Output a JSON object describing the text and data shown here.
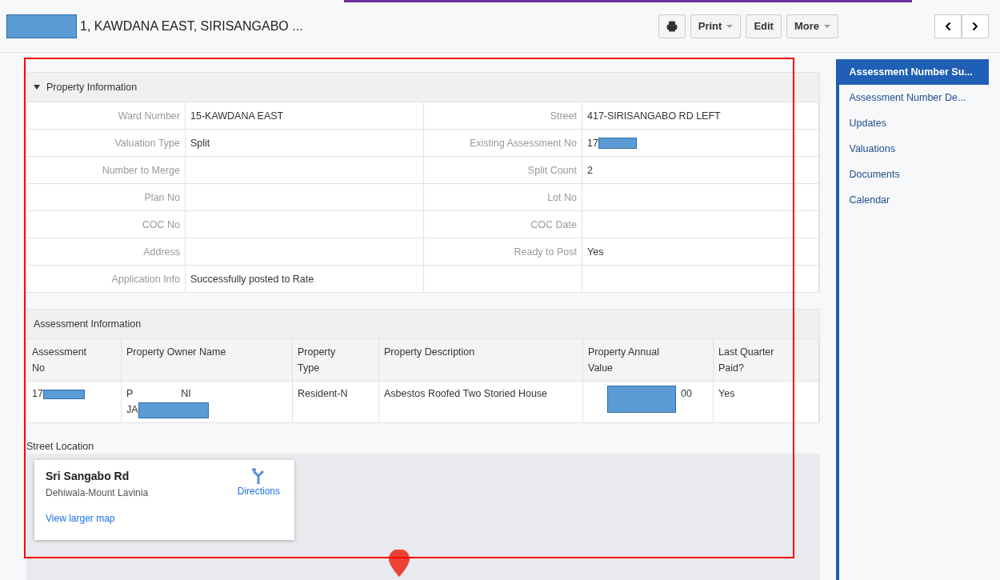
{
  "header": {
    "title": "1, KAWDANA EAST, SIRISANGABO ...",
    "buttons": [
      {
        "kind": "icon"
      },
      {
        "kind": "dropdown",
        "label": "Print"
      },
      {
        "kind": "plain",
        "label": "Edit"
      },
      {
        "kind": "dropdown",
        "label": "More"
      }
    ]
  },
  "property_information": {
    "title": "Property Information",
    "expanded": true,
    "rows": [
      {
        "left_label": "Ward Number",
        "left_value": "15-KAWDANA EAST",
        "right_label": "Street",
        "right_value": "417-SIRISANGABO RD LEFT"
      },
      {
        "left_label": "Valuation Type",
        "left_value": "Split",
        "right_label": "Existing Assessment No",
        "right_value": "17",
        "right_redacted": true
      },
      {
        "left_label": "Number to Merge",
        "right_label": "Split Count",
        "right_value": "2"
      },
      {
        "left_label": "Plan No",
        "right_label": "Lot No"
      },
      {
        "left_label": "COC No",
        "right_label": "COC Date"
      },
      {
        "left_label": "Address",
        "right_label": "Ready to Post",
        "right_value": "Yes"
      },
      {
        "left_label": "Application Info",
        "left_value": "Successfully posted to Rate"
      }
    ]
  },
  "assessment_information": {
    "title": "Assessment Information",
    "columns": [
      "Assessment No",
      "Property Owner Name",
      "Property Type",
      "Property Description",
      "Property Annual Value",
      "Last Quarter Paid?"
    ],
    "rows": [
      {
        "assessment_no": "17",
        "owner_line_1": "P",
        "owner_line_1_end": "NI",
        "owner_line_2": "JA",
        "property_type": "Resident-N",
        "description": "Asbestos Roofed Two Storied House",
        "annual_value": "00",
        "last_quarter_paid": "Yes"
      }
    ]
  },
  "street_location": {
    "title": "Street Location",
    "place": "Sri Sangabo Rd",
    "area": "Dehiwala-Mount Lavinia",
    "directions": "Directions",
    "larger_map": "View larger map"
  },
  "side_nav": [
    {
      "label": "Assessment Number Su...",
      "selected": true
    },
    {
      "label": "Assessment Number De...",
      "selected": false
    },
    {
      "label": "Updates",
      "selected": false
    },
    {
      "label": "Valuations",
      "selected": false
    },
    {
      "label": "Documents",
      "selected": false
    },
    {
      "label": "Calendar",
      "selected": false
    }
  ]
}
